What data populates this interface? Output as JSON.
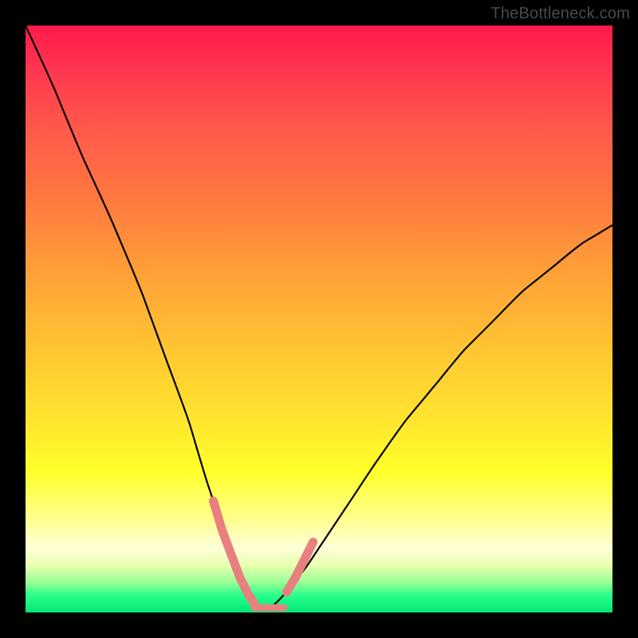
{
  "watermark": "TheBottleneck.com",
  "chart_data": {
    "type": "line",
    "title": "",
    "xlabel": "",
    "ylabel": "",
    "xlim": [
      0,
      100
    ],
    "ylim": [
      0,
      100
    ],
    "grid": false,
    "series": [
      {
        "name": "black-curve",
        "x": [
          0,
          5,
          10,
          15,
          20,
          24,
          28,
          31,
          34,
          36,
          38,
          40,
          42,
          44,
          48,
          52,
          56,
          60,
          65,
          70,
          75,
          80,
          85,
          90,
          95,
          100
        ],
        "values": [
          100,
          89,
          77,
          66,
          54,
          43,
          32,
          22,
          13,
          7,
          3,
          1,
          1,
          3,
          8,
          14,
          20,
          26,
          33,
          39,
          45,
          50,
          55,
          59,
          63,
          66
        ]
      }
    ],
    "markers": [
      {
        "name": "pink-dots-left",
        "x": [
          32.0,
          33.5,
          35.0,
          36.5,
          38.0,
          39.0
        ],
        "values": [
          19,
          14,
          10,
          6,
          3,
          1.5
        ],
        "color": "#e98080",
        "size": 11
      },
      {
        "name": "pink-dots-right",
        "x": [
          44.5,
          46.0,
          47.5,
          49.0
        ],
        "values": [
          3.5,
          6,
          9,
          12
        ],
        "color": "#e98080",
        "size": 11
      }
    ],
    "bottom_bar": {
      "x_start": 39,
      "x_end": 44,
      "color": "#e98080",
      "thickness": 9
    }
  }
}
